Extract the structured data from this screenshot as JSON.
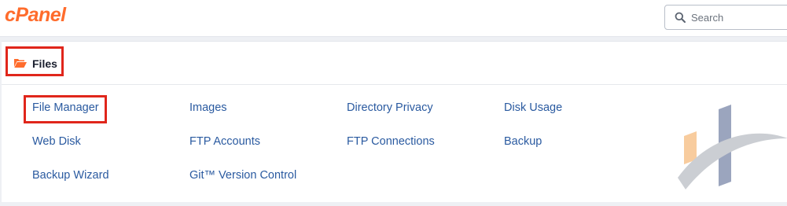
{
  "header": {
    "logo_text": "cPanel",
    "search": {
      "placeholder": "Search",
      "value": ""
    }
  },
  "section": {
    "title": "Files",
    "icon": "folder-open-icon"
  },
  "links": [
    {
      "label": "File Manager"
    },
    {
      "label": "Images"
    },
    {
      "label": "Directory Privacy"
    },
    {
      "label": "Disk Usage"
    },
    {
      "label": "Web Disk"
    },
    {
      "label": "FTP Accounts"
    },
    {
      "label": "FTP Connections"
    },
    {
      "label": "Backup"
    },
    {
      "label": "Backup Wizard"
    },
    {
      "label": "Git™ Version Control"
    }
  ],
  "colors": {
    "brand": "#ff6c2c",
    "link": "#2a5aa0",
    "highlight": "#e0261b"
  }
}
